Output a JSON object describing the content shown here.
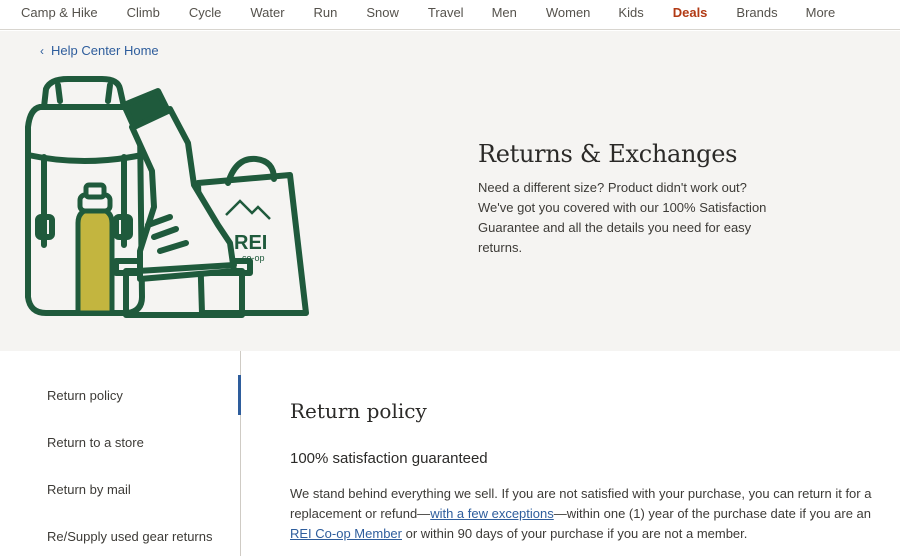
{
  "topnav": {
    "items": [
      "Camp & Hike",
      "Climb",
      "Cycle",
      "Water",
      "Run",
      "Snow",
      "Travel",
      "Men",
      "Women",
      "Kids",
      "Deals",
      "Brands",
      "More"
    ]
  },
  "breadcrumb": {
    "label": "Help Center Home"
  },
  "hero": {
    "title": "Returns & Exchanges",
    "description": "Need a different size? Product didn't work out? We've got you covered with our 100% Satisfaction Guarantee and all the details you need for easy returns.",
    "logo_text": "REI",
    "logo_subtext": "co-op"
  },
  "sidebar": {
    "items": [
      "Return policy",
      "Return to a store",
      "Return by mail",
      "Re/Supply used gear returns"
    ]
  },
  "content": {
    "title": "Return policy",
    "subtitle": "100% satisfaction guaranteed",
    "para_part1": "We stand behind everything we sell. If you are not satisfied with your purchase, you can return it for a replacement or refund—",
    "exceptions_link": "with a few exceptions",
    "para_part2": "—within one (1) year of the purchase date if you are an ",
    "member_link": "REI Co-op Member",
    "para_part3": " or within 90 days of your purchase if you are not a member."
  },
  "colors": {
    "accent_link": "#2e5d9c",
    "deals": "#b23a14",
    "illustration_green": "#1f5a3c",
    "bottle_yellow": "#c3b53f"
  }
}
